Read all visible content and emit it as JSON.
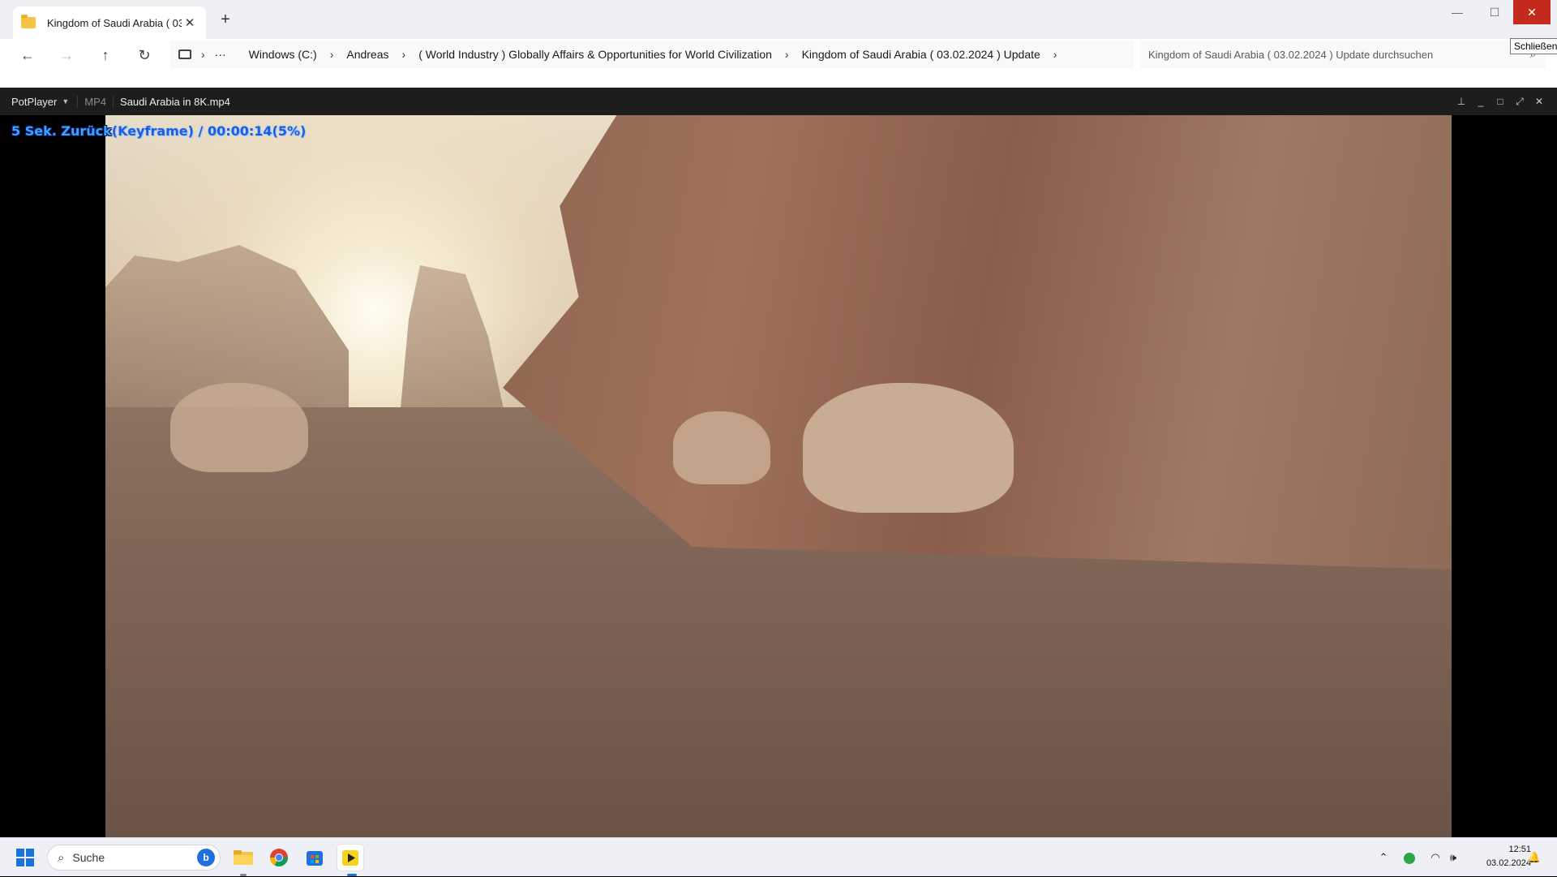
{
  "explorer": {
    "tab_title": "Kingdom of Saudi Arabia ( 03.02.2024 ) Update",
    "new_tab": "+",
    "tooltip": "Schließen",
    "breadcrumbs": [
      "Windows (C:)",
      "Andreas",
      "( World Industry ) Globally Affairs & Opportunities for World Civilization",
      "Kingdom of Saudi Arabia ( 03.02.2024 ) Update"
    ],
    "search_placeholder": "Kingdom of Saudi Arabia ( 03.02.2024 ) Update durchsuchen",
    "icons": [
      "folder-icon",
      "back-icon",
      "forward-icon",
      "up-icon",
      "refresh-icon",
      "computer-icon",
      "more-icon",
      "search-icon"
    ]
  },
  "player": {
    "brand": "PotPlayer",
    "format": "MP4",
    "filename": "Saudi Arabia in 8K.mp4",
    "osd_prefix": "5 Sek. Zurück",
    "osd_rest": "(Keyframe) / 00:00:14(5%)"
  },
  "taskbar": {
    "search_label": "Suche",
    "time": "12:51",
    "date": "03.02.2024",
    "apps": [
      "file-explorer-icon",
      "chrome-icon",
      "store-icon",
      "potplayer-icon"
    ]
  }
}
